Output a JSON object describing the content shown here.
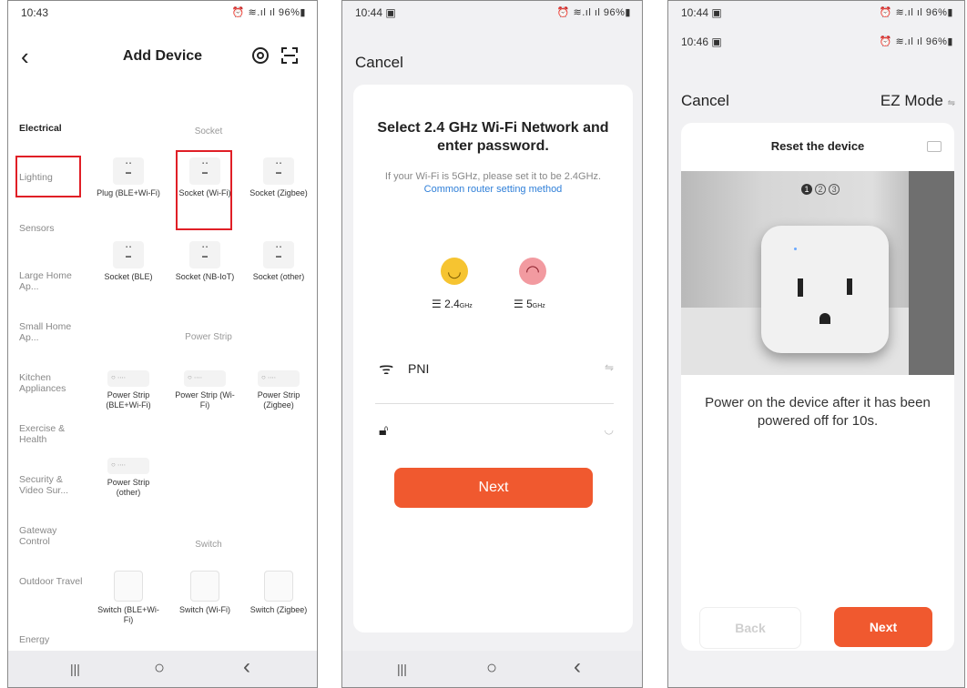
{
  "panel1": {
    "status": {
      "time": "10:43",
      "icons": "⏰ ≋.ıl ıl 96%▮"
    },
    "title": "Add Device",
    "back": "‹",
    "categories": [
      "Electrical",
      "Lighting",
      "Sensors",
      "Large Home Ap...",
      "Small Home Ap...",
      "Kitchen Appliances",
      "Exercise & Health",
      "Security & Video Sur...",
      "Gateway Control",
      "Outdoor Travel",
      "Energy"
    ],
    "sections": {
      "socket": "Socket",
      "power_strip": "Power Strip",
      "switch": "Switch"
    },
    "socket_items": [
      "Plug (BLE+Wi-Fi)",
      "Socket (Wi-Fi)",
      "Socket (Zigbee)",
      "Socket (BLE)",
      "Socket (NB-IoT)",
      "Socket (other)"
    ],
    "strip_items": [
      "Power Strip (BLE+Wi-Fi)",
      "Power Strip (Wi-Fi)",
      "Power Strip (Zigbee)",
      "Power Strip (other)"
    ],
    "switch_items": [
      "Switch (BLE+Wi-Fi)",
      "Switch (Wi-Fi)",
      "Switch (Zigbee)"
    ],
    "nav": {
      "recent": "|||",
      "home": "○",
      "back": "‹"
    }
  },
  "panel2": {
    "status": {
      "time": "10:44 ▣",
      "icons": "⏰ ≋.ıl ıl 96%▮"
    },
    "cancel": "Cancel",
    "heading": "Select 2.4 GHz Wi-Fi Network and enter password.",
    "hint": "If your Wi-Fi is 5GHz, please set it to be 2.4GHz.",
    "link": "Common router setting method",
    "band_ok": "2.4",
    "band_ok_unit": "GHz",
    "band_bad": "5",
    "band_bad_unit": "GHz",
    "ssid": "PNI",
    "password": "",
    "next": "Next",
    "nav": {
      "recent": "|||",
      "home": "○",
      "back": "‹"
    }
  },
  "panel3": {
    "status_top": {
      "time": "10:44 ▣",
      "icons": "⏰ ≋.ıl ıl 96%▮"
    },
    "status_second": {
      "time": "10:46 ▣",
      "icons": "⏰ ≋.ıl ıl 96%▮"
    },
    "cancel": "Cancel",
    "mode": "EZ Mode",
    "card_title": "Reset the device",
    "steps": [
      "1",
      "2",
      "3"
    ],
    "instruction": "Power on the device after it has been powered off for 10s.",
    "back": "Back",
    "next": "Next"
  },
  "colors": {
    "accent": "#f0592f",
    "highlight": "#e01f26",
    "link": "#2f7fd8"
  }
}
